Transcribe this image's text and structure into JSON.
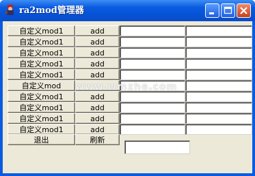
{
  "window": {
    "title": "ra2mod管理器",
    "controls": {
      "minimize": "minimize-icon",
      "maximize": "maximize-icon",
      "close": "close-icon"
    }
  },
  "rows": [
    {
      "mod_label": "自定义mod1",
      "add_label": "add"
    },
    {
      "mod_label": "自定义mod1",
      "add_label": "add"
    },
    {
      "mod_label": "自定义mod1",
      "add_label": "add"
    },
    {
      "mod_label": "自定义mod1",
      "add_label": "add"
    },
    {
      "mod_label": "自定义mod1",
      "add_label": "add"
    },
    {
      "mod_label": "自定义mod",
      "add_label": ""
    },
    {
      "mod_label": "自定义mod1",
      "add_label": "add"
    },
    {
      "mod_label": "自定义mod1",
      "add_label": "add"
    },
    {
      "mod_label": "自定义mod1",
      "add_label": "add"
    },
    {
      "mod_label": "自定义mod1",
      "add_label": "add"
    }
  ],
  "footer": {
    "exit_label": "退出",
    "refresh_label": "刷新"
  },
  "watermark": "www.wmzhe.com",
  "colors": {
    "titlebar": "#0a5be0",
    "face": "#ece9d8"
  }
}
